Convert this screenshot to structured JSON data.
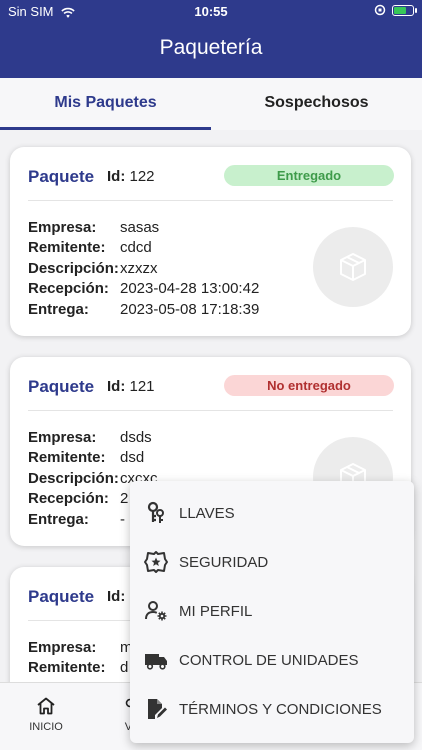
{
  "status_bar": {
    "carrier": "Sin SIM",
    "time": "10:55"
  },
  "header": {
    "title": "Paquetería"
  },
  "tabs": [
    {
      "label": "Mis Paquetes",
      "active": true
    },
    {
      "label": "Sospechosos",
      "active": false
    }
  ],
  "labels": {
    "package": "Paquete",
    "id": "Id:",
    "empresa": "Empresa:",
    "remitente": "Remitente:",
    "descripcion": "Descripción:",
    "recepcion": "Recepción:",
    "entrega": "Entrega:"
  },
  "packages": [
    {
      "id": "122",
      "status": "Entregado",
      "empresa": "sasas",
      "remitente": "cdcd",
      "descripcion": "xzxzx",
      "recepcion": "2023-04-28 13:00:42",
      "entrega": "2023-05-08 17:18:39"
    },
    {
      "id": "121",
      "status": "No entregado",
      "empresa": "dsds",
      "remitente": "dsd",
      "descripcion": "cxcxc",
      "recepcion": "2",
      "entrega": "-"
    },
    {
      "id": "",
      "status": "",
      "empresa": "m",
      "remitente": "d",
      "descripcion": "",
      "recepcion": "",
      "entrega": ""
    }
  ],
  "menu": [
    {
      "label": "LLAVES",
      "icon": "keys-icon"
    },
    {
      "label": "SEGURIDAD",
      "icon": "security-badge-icon"
    },
    {
      "label": "MI PERFIL",
      "icon": "user-settings-icon"
    },
    {
      "label": "CONTROL DE UNIDADES",
      "icon": "truck-icon"
    },
    {
      "label": "TÉRMINOS Y CONDICIONES",
      "icon": "document-edit-icon"
    }
  ],
  "bottom_nav": [
    {
      "label": "INICIO",
      "icon": "home-icon"
    },
    {
      "label": "VI",
      "icon": "visits-icon"
    }
  ],
  "colors": {
    "primary": "#2e3a8c",
    "delivered_bg": "#c8f0cd",
    "delivered_text": "#3e9b4a",
    "undelivered_bg": "#fbd6d6",
    "undelivered_text": "#b03030"
  }
}
